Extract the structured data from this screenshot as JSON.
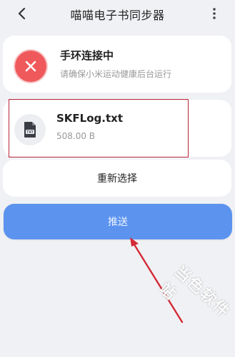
{
  "header": {
    "title": "喵喵电子书同步器",
    "back_icon": "chevron-left-icon",
    "more_icon": "vertical-dots-icon"
  },
  "status": {
    "icon": "error-x-icon",
    "title": "手环连接中",
    "subtitle": "请确保小米运动健康后台运行",
    "color": "#f0595c"
  },
  "file": {
    "icon": "txt-file-icon",
    "name": "SKFLog.txt",
    "size": "508.00 B"
  },
  "actions": {
    "reselect_label": "重新选择",
    "push_label": "推送",
    "accent": "#5c93ef"
  },
  "annotation": {
    "highlight_color": "#b9263a",
    "watermark": "当色软件站"
  }
}
